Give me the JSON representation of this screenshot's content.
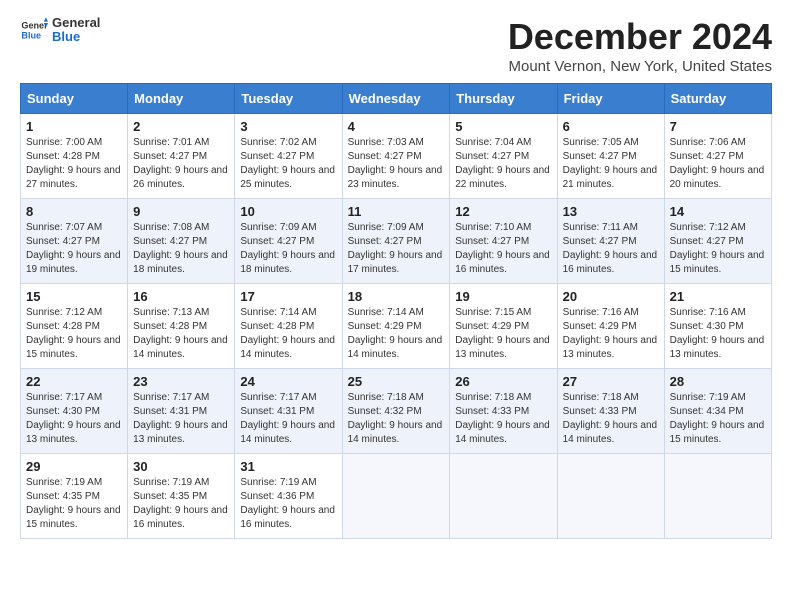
{
  "logo": {
    "line1": "General",
    "line2": "Blue"
  },
  "title": "December 2024",
  "subtitle": "Mount Vernon, New York, United States",
  "days_of_week": [
    "Sunday",
    "Monday",
    "Tuesday",
    "Wednesday",
    "Thursday",
    "Friday",
    "Saturday"
  ],
  "weeks": [
    [
      {
        "day": "1",
        "sunrise": "7:00 AM",
        "sunset": "4:28 PM",
        "daylight": "9 hours and 27 minutes."
      },
      {
        "day": "2",
        "sunrise": "7:01 AM",
        "sunset": "4:27 PM",
        "daylight": "9 hours and 26 minutes."
      },
      {
        "day": "3",
        "sunrise": "7:02 AM",
        "sunset": "4:27 PM",
        "daylight": "9 hours and 25 minutes."
      },
      {
        "day": "4",
        "sunrise": "7:03 AM",
        "sunset": "4:27 PM",
        "daylight": "9 hours and 23 minutes."
      },
      {
        "day": "5",
        "sunrise": "7:04 AM",
        "sunset": "4:27 PM",
        "daylight": "9 hours and 22 minutes."
      },
      {
        "day": "6",
        "sunrise": "7:05 AM",
        "sunset": "4:27 PM",
        "daylight": "9 hours and 21 minutes."
      },
      {
        "day": "7",
        "sunrise": "7:06 AM",
        "sunset": "4:27 PM",
        "daylight": "9 hours and 20 minutes."
      }
    ],
    [
      {
        "day": "8",
        "sunrise": "7:07 AM",
        "sunset": "4:27 PM",
        "daylight": "9 hours and 19 minutes."
      },
      {
        "day": "9",
        "sunrise": "7:08 AM",
        "sunset": "4:27 PM",
        "daylight": "9 hours and 18 minutes."
      },
      {
        "day": "10",
        "sunrise": "7:09 AM",
        "sunset": "4:27 PM",
        "daylight": "9 hours and 18 minutes."
      },
      {
        "day": "11",
        "sunrise": "7:09 AM",
        "sunset": "4:27 PM",
        "daylight": "9 hours and 17 minutes."
      },
      {
        "day": "12",
        "sunrise": "7:10 AM",
        "sunset": "4:27 PM",
        "daylight": "9 hours and 16 minutes."
      },
      {
        "day": "13",
        "sunrise": "7:11 AM",
        "sunset": "4:27 PM",
        "daylight": "9 hours and 16 minutes."
      },
      {
        "day": "14",
        "sunrise": "7:12 AM",
        "sunset": "4:27 PM",
        "daylight": "9 hours and 15 minutes."
      }
    ],
    [
      {
        "day": "15",
        "sunrise": "7:12 AM",
        "sunset": "4:28 PM",
        "daylight": "9 hours and 15 minutes."
      },
      {
        "day": "16",
        "sunrise": "7:13 AM",
        "sunset": "4:28 PM",
        "daylight": "9 hours and 14 minutes."
      },
      {
        "day": "17",
        "sunrise": "7:14 AM",
        "sunset": "4:28 PM",
        "daylight": "9 hours and 14 minutes."
      },
      {
        "day": "18",
        "sunrise": "7:14 AM",
        "sunset": "4:29 PM",
        "daylight": "9 hours and 14 minutes."
      },
      {
        "day": "19",
        "sunrise": "7:15 AM",
        "sunset": "4:29 PM",
        "daylight": "9 hours and 13 minutes."
      },
      {
        "day": "20",
        "sunrise": "7:16 AM",
        "sunset": "4:29 PM",
        "daylight": "9 hours and 13 minutes."
      },
      {
        "day": "21",
        "sunrise": "7:16 AM",
        "sunset": "4:30 PM",
        "daylight": "9 hours and 13 minutes."
      }
    ],
    [
      {
        "day": "22",
        "sunrise": "7:17 AM",
        "sunset": "4:30 PM",
        "daylight": "9 hours and 13 minutes."
      },
      {
        "day": "23",
        "sunrise": "7:17 AM",
        "sunset": "4:31 PM",
        "daylight": "9 hours and 13 minutes."
      },
      {
        "day": "24",
        "sunrise": "7:17 AM",
        "sunset": "4:31 PM",
        "daylight": "9 hours and 14 minutes."
      },
      {
        "day": "25",
        "sunrise": "7:18 AM",
        "sunset": "4:32 PM",
        "daylight": "9 hours and 14 minutes."
      },
      {
        "day": "26",
        "sunrise": "7:18 AM",
        "sunset": "4:33 PM",
        "daylight": "9 hours and 14 minutes."
      },
      {
        "day": "27",
        "sunrise": "7:18 AM",
        "sunset": "4:33 PM",
        "daylight": "9 hours and 14 minutes."
      },
      {
        "day": "28",
        "sunrise": "7:19 AM",
        "sunset": "4:34 PM",
        "daylight": "9 hours and 15 minutes."
      }
    ],
    [
      {
        "day": "29",
        "sunrise": "7:19 AM",
        "sunset": "4:35 PM",
        "daylight": "9 hours and 15 minutes."
      },
      {
        "day": "30",
        "sunrise": "7:19 AM",
        "sunset": "4:35 PM",
        "daylight": "9 hours and 16 minutes."
      },
      {
        "day": "31",
        "sunrise": "7:19 AM",
        "sunset": "4:36 PM",
        "daylight": "9 hours and 16 minutes."
      },
      null,
      null,
      null,
      null
    ]
  ],
  "labels": {
    "sunrise": "Sunrise:",
    "sunset": "Sunset:",
    "daylight": "Daylight:"
  }
}
